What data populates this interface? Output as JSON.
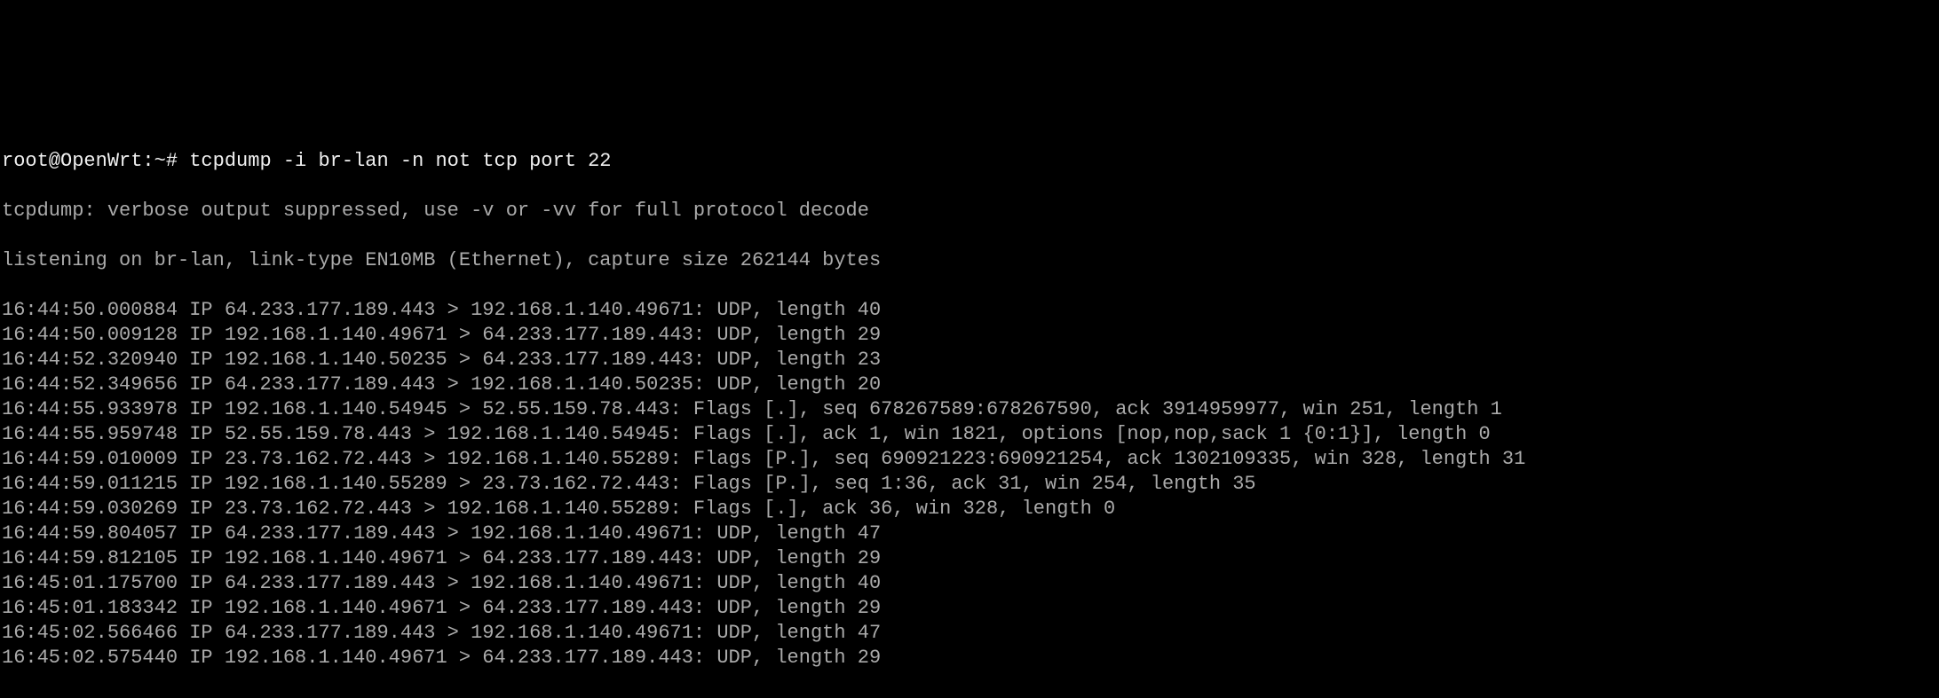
{
  "prompt_prefix": "root@OpenWrt:~# ",
  "command": "tcpdump -i br-lan -n not tcp port 22",
  "header_line_1": "tcpdump: verbose output suppressed, use -v or -vv for full protocol decode",
  "header_line_2": "listening on br-lan, link-type EN10MB (Ethernet), capture size 262144 bytes",
  "packets": [
    "16:44:50.000884 IP 64.233.177.189.443 > 192.168.1.140.49671: UDP, length 40",
    "16:44:50.009128 IP 192.168.1.140.49671 > 64.233.177.189.443: UDP, length 29",
    "16:44:52.320940 IP 192.168.1.140.50235 > 64.233.177.189.443: UDP, length 23",
    "16:44:52.349656 IP 64.233.177.189.443 > 192.168.1.140.50235: UDP, length 20",
    "16:44:55.933978 IP 192.168.1.140.54945 > 52.55.159.78.443: Flags [.], seq 678267589:678267590, ack 3914959977, win 251, length 1",
    "16:44:55.959748 IP 52.55.159.78.443 > 192.168.1.140.54945: Flags [.], ack 1, win 1821, options [nop,nop,sack 1 {0:1}], length 0",
    "16:44:59.010009 IP 23.73.162.72.443 > 192.168.1.140.55289: Flags [P.], seq 690921223:690921254, ack 1302109335, win 328, length 31",
    "16:44:59.011215 IP 192.168.1.140.55289 > 23.73.162.72.443: Flags [P.], seq 1:36, ack 31, win 254, length 35",
    "16:44:59.030269 IP 23.73.162.72.443 > 192.168.1.140.55289: Flags [.], ack 36, win 328, length 0",
    "16:44:59.804057 IP 64.233.177.189.443 > 192.168.1.140.49671: UDP, length 47",
    "16:44:59.812105 IP 192.168.1.140.49671 > 64.233.177.189.443: UDP, length 29",
    "16:45:01.175700 IP 64.233.177.189.443 > 192.168.1.140.49671: UDP, length 40",
    "16:45:01.183342 IP 192.168.1.140.49671 > 64.233.177.189.443: UDP, length 29",
    "16:45:02.566466 IP 64.233.177.189.443 > 192.168.1.140.49671: UDP, length 47",
    "16:45:02.575440 IP 192.168.1.140.49671 > 64.233.177.189.443: UDP, length 29"
  ],
  "wrap_cols": 164
}
